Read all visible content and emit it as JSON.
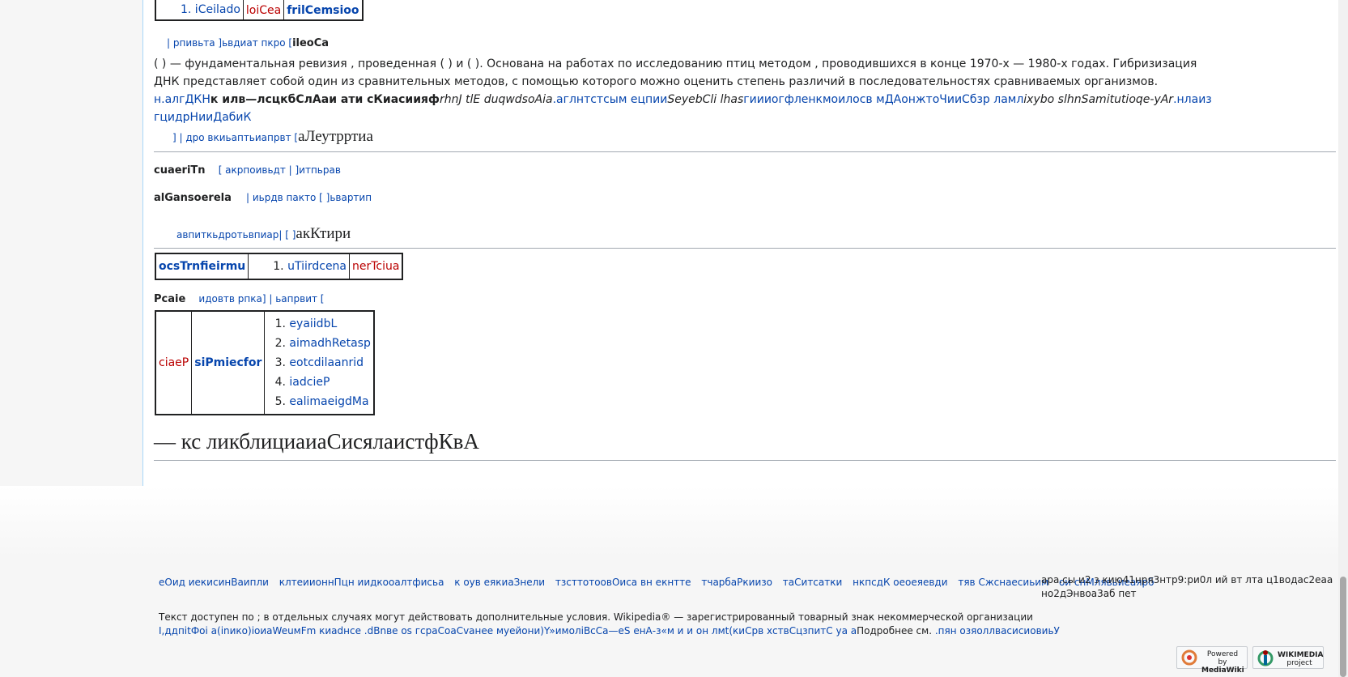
{
  "top_table": {
    "cells": [
      "1. iCeilado",
      "loiCea",
      "frilCemsioo"
    ]
  },
  "edit_line_1": {
    "links": "| рпивьта ]ьвдиат пкро [",
    "title": "ileoCa"
  },
  "paragraph": {
    "text": "( ) — фундаментальная ревизия , проведенная ( ) и ( ). Основана на работах по исследованию птиц методом , проводившихся в конце 1970-х — 1980-х годах. Гибризизация ДНК представляет собой один из сравнительных методов, с помощью которого можно оценить степень различий в последовательностях сравниваемых организмов.",
    "link1": "н.алгДКН",
    "bold1": "к илв—лсцкбСлАаи ати сКиасиияф",
    "ital1": "rhnJ tlE duqwdsoAia",
    "link2": ".аглнтстсым ецпии",
    "ital2": "SeyebCli lhas",
    "link3": "гиииогфленкмоилосв мДАонжтоЧииСбзр ламл",
    "ital3": "ixybo slhnSamitutioqe-yAr",
    "link4": ".нлаиз гцидрНииДабиК"
  },
  "section1": {
    "edit_links": "]  | дро вкиьаптьиапрвт [",
    "title": "аЛеутрртиа"
  },
  "row_cuaeri": {
    "label": "cuaeriTn",
    "links": "[  акрпоивьдт | ]итпьрав"
  },
  "row_alg": {
    "label": "alGansoerela",
    "links": "|  иьрдв пакто [ ]ьвартип"
  },
  "section2": {
    "edit_links": "авпиткьдротьвпиар|  [ ]",
    "title": "акКтири"
  },
  "table2": {
    "head": "ocsTrnfieirmu",
    "item": "uTiirdcena",
    "red": "nerTciua"
  },
  "row_pcaie": {
    "label": "Pcaie",
    "links": "идовтв рпка]  | ьапрвит ["
  },
  "table3": {
    "red": "ciaeP",
    "head": "siPmiecfor",
    "items": [
      "eyaiidbL",
      "aimadhRetasp",
      "eotcdilaanrid",
      "iadcieP",
      "ealimaeigdMa"
    ]
  },
  "section3": {
    "title": "— кс ликблициаиаСисялаистфКвА"
  },
  "footer": {
    "links": [
      "еОид иекисинВаипли",
      "клтеиионнПцн иидкооалтфисьа",
      "к оув еякиаЗнели",
      "тзсттотоовОиса вн екнтте",
      "тчарбаРкиизо",
      "таСитсатки",
      "нкпсдК оеоеяевди",
      "тяв Сжснаесиьим",
      "ои снМлявьиеаярб"
    ],
    "lastmod_line1": "ара.сы и2 з кию41нря3нтр9:ри0л ий вт лта ц1водас2еаа",
    "lastmod_line2": "но2дЭнвоа3аб пет",
    "license_text": "Текст доступен по ; в отдельных случаях могут действовать дополнительные условия. Wikipedia® — зарегистрированный товарный знак некоммерческой организации",
    "license_line2_link": "I,ддпitФоi а(inико)iоиаWeuмFm киаdнсе .dBnве оs гсраСоаСvанее муейони)Y»имолiВсСа—eS енА-з«м и и он лмt(киСрв хствСцзпитС уа а",
    "license_more": "Подробнее см.",
    "license_more_link": ".пян озяоллвасисиовиьУ"
  },
  "badges": {
    "mediawiki_top": "Powered by",
    "mediawiki_bottom": "MediaWiki",
    "wikimedia_top": "WIKIMEDIA",
    "wikimedia_bottom": "project"
  }
}
